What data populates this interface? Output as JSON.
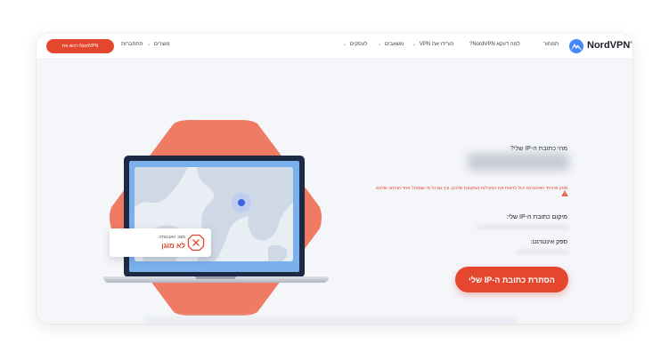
{
  "header": {
    "brand": "NordVPN",
    "cta_label": "רכשו את NordVPN",
    "nav_left": [
      "התחברות",
      "מוצרים"
    ],
    "nav_right": [
      "תמחור",
      "למה דווקא NordVPN?",
      "הורידו את VPN",
      "משאבים",
      "לעסקים"
    ]
  },
  "main": {
    "status_label": "מצב האבטחה",
    "status_value": "לא מוגן",
    "ip_title": "מהי כתובת ה-IP שלי?",
    "warning_text": "ספק שירותי האינטרנט יכול לראות את הפעילות המקוונת שלכם, וכך גם כל מי שמנהל אחר הניתוב שלכם.",
    "location_label": "מיקום כתובת ה-IP שלי:",
    "isp_label": "ספק אינטרנט:",
    "hide_button": "הסתרת כתובת ה-IP שלי"
  },
  "colors": {
    "accent": "#e5472e",
    "hexagon": "#ef7b63",
    "laptop_screen": "#7ab1ec",
    "logo_blue": "#4687ff"
  },
  "icons": {
    "logo": "nordvpn-mountain-icon",
    "status": "x-octagon-icon",
    "warning": "warning-triangle-icon",
    "location": "location-pin-icon",
    "dropdown": "chevron-down-icon"
  }
}
